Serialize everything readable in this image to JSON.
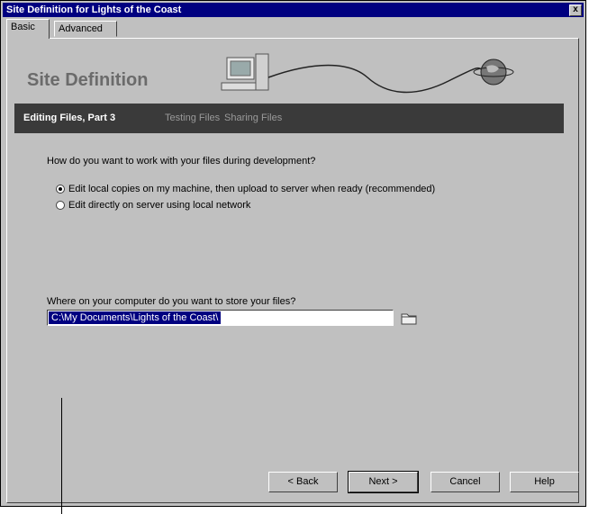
{
  "window": {
    "title": "Site Definition for Lights of the Coast",
    "close_glyph": "x"
  },
  "tabs": [
    {
      "label": "Basic"
    },
    {
      "label": "Advanced"
    }
  ],
  "header": {
    "title": "Site Definition"
  },
  "steps": {
    "current": "Editing Files, Part 3",
    "next1": "Testing Files",
    "next2": "Sharing Files"
  },
  "question": "How do you want to work with your files during development?",
  "options": [
    {
      "label": "Edit local copies on my machine, then upload to server when ready (recommended)",
      "checked": true
    },
    {
      "label": "Edit directly on server using local network",
      "checked": false
    }
  ],
  "location": {
    "label": "Where on your computer do you want to store your files?",
    "value": "C:\\My Documents\\Lights of the Coast\\"
  },
  "buttons": {
    "back": "< Back",
    "next": "Next >",
    "cancel": "Cancel",
    "help": "Help"
  },
  "colors": {
    "titlebar": "#000080",
    "step_bar": "#3a3a3a",
    "face": "#c0c0c0"
  }
}
